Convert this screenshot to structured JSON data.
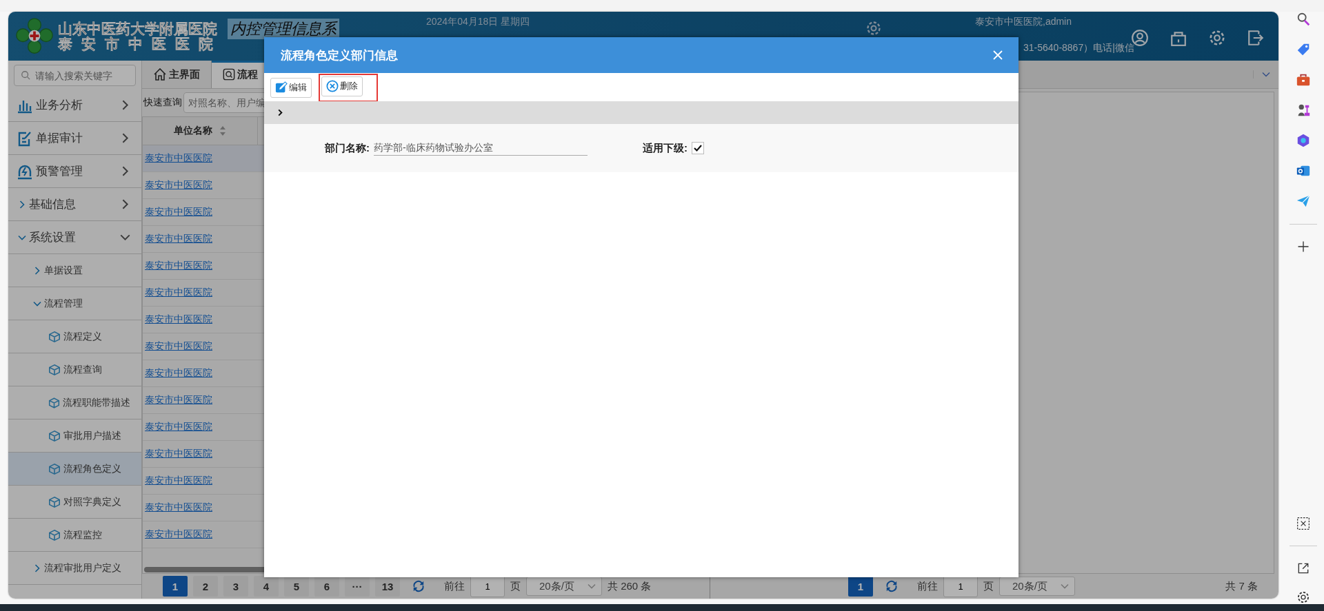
{
  "header": {
    "hospital_name": "山东中医药大学附属医院",
    "hospital_name_2": "泰安市中医医院",
    "system_name": "内控管理信息系",
    "date": "2024年04月18日 星期四",
    "user": "泰安市中医医院,admin",
    "contact": "31-5640-8867）电话|微信"
  },
  "sidebar": {
    "search_placeholder": "请输入搜索关键字",
    "items": [
      {
        "label": "业务分析",
        "kind": "module",
        "expanded": false,
        "selected": false
      },
      {
        "label": "单据审计",
        "kind": "module",
        "expanded": false,
        "selected": false
      },
      {
        "label": "预警管理",
        "kind": "module",
        "expanded": false,
        "selected": false
      },
      {
        "label": "基础信息",
        "kind": "group",
        "expanded": false,
        "selected": false
      },
      {
        "label": "系统设置",
        "kind": "group",
        "expanded": true,
        "selected": false,
        "children": [
          {
            "label": "单据设置",
            "kind": "group",
            "expanded": false,
            "selected": false
          },
          {
            "label": "流程管理",
            "kind": "group",
            "expanded": true,
            "selected": false,
            "children": [
              {
                "label": "流程定义",
                "kind": "leaf",
                "selected": false
              },
              {
                "label": "流程查询",
                "kind": "leaf",
                "selected": false
              },
              {
                "label": "流程职能带描述",
                "kind": "leaf",
                "selected": false
              },
              {
                "label": "审批用户描述",
                "kind": "leaf",
                "selected": false
              },
              {
                "label": "流程角色定义",
                "kind": "leaf",
                "selected": true
              },
              {
                "label": "对照字典定义",
                "kind": "leaf",
                "selected": false
              },
              {
                "label": "流程监控",
                "kind": "leaf",
                "selected": false
              }
            ]
          },
          {
            "label": "流程审批用户定义",
            "kind": "group",
            "expanded": false,
            "selected": false
          }
        ]
      }
    ]
  },
  "tabs": [
    {
      "label": "主界面",
      "selected": false
    },
    {
      "label": "流程",
      "selected": true
    }
  ],
  "quick_search": {
    "label": "快速查询",
    "placeholder": "对照名称、用户编"
  },
  "table": {
    "columns": [
      {
        "label": "单位名称"
      }
    ],
    "rows": [
      {
        "cells": [
          "泰安市中医医院"
        ],
        "selected": true
      },
      {
        "cells": [
          "泰安市中医医院"
        ],
        "selected": false
      },
      {
        "cells": [
          "泰安市中医医院"
        ],
        "selected": false
      },
      {
        "cells": [
          "泰安市中医医院"
        ],
        "selected": false
      },
      {
        "cells": [
          "泰安市中医医院"
        ],
        "selected": false
      },
      {
        "cells": [
          "泰安市中医医院"
        ],
        "selected": false
      },
      {
        "cells": [
          "泰安市中医医院"
        ],
        "selected": false
      },
      {
        "cells": [
          "泰安市中医医院"
        ],
        "selected": false
      },
      {
        "cells": [
          "泰安市中医医院"
        ],
        "selected": false
      },
      {
        "cells": [
          "泰安市中医医院"
        ],
        "selected": false
      },
      {
        "cells": [
          "泰安市中医医院"
        ],
        "selected": false
      },
      {
        "cells": [
          "泰安市中医医院"
        ],
        "selected": false
      },
      {
        "cells": [
          "泰安市中医医院"
        ],
        "selected": false
      },
      {
        "cells": [
          "泰安市中医医院"
        ],
        "selected": false
      },
      {
        "cells": [
          "泰安市中医医院"
        ],
        "selected": false
      }
    ]
  },
  "pagination": [
    {
      "pages": [
        {
          "label": "1",
          "selected": true
        },
        {
          "label": "2",
          "selected": false
        },
        {
          "label": "3",
          "selected": false
        },
        {
          "label": "4",
          "selected": false
        },
        {
          "label": "5",
          "selected": false
        },
        {
          "label": "6",
          "selected": false
        },
        {
          "label": "···",
          "selected": false
        },
        {
          "label": "13",
          "selected": false
        }
      ],
      "goto_label": "前往",
      "page_input": "1",
      "page_unit": "页",
      "page_size": "20条/页",
      "total": "共 260 条"
    },
    {
      "pages": [
        {
          "label": "1",
          "selected": true
        }
      ],
      "goto_label": "前往",
      "page_input": "1",
      "page_unit": "页",
      "page_size": "20条/页",
      "total": "共 7 条"
    }
  ],
  "dialog": {
    "title": "流程角色定义部门信息",
    "toolbar": [
      {
        "label": "编辑",
        "kind": "edit",
        "highlighted": false
      },
      {
        "label": "删除",
        "kind": "delete",
        "highlighted": true
      }
    ],
    "fields": [
      {
        "label": "部门名称:",
        "kind": "text",
        "value": "药学部-临床药物试验办公室"
      },
      {
        "label": "适用下级:",
        "kind": "checkbox",
        "checked": true
      }
    ]
  }
}
